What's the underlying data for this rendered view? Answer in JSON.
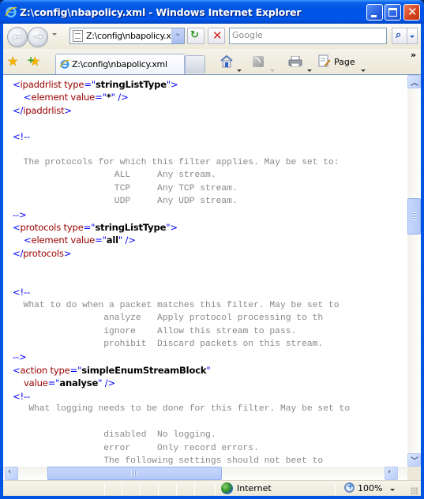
{
  "window": {
    "title": "Z:\\config\\nbapolicy.xml - Windows Internet Explorer"
  },
  "navbar": {
    "address_value": "Z:\\config\\nbapolicy.xml",
    "search_placeholder": "Google",
    "back_glyph": "←",
    "forward_glyph": "→",
    "refresh_glyph": "↻",
    "stop_glyph": "✕",
    "search_glyph": "⌕"
  },
  "tabs": [
    {
      "label": "Z:\\config\\nbapolicy.xml",
      "active": true
    }
  ],
  "command_bar": {
    "page_label": "Page",
    "more_glyph": "»"
  },
  "content": {
    "lines": [
      {
        "kind": "xml",
        "indent": 0,
        "parts": [
          [
            "blue",
            "<"
          ],
          [
            "tag",
            "ipaddrlist"
          ],
          [
            "attr",
            " type"
          ],
          [
            "blue",
            "=\""
          ],
          [
            "val",
            "stringListType"
          ],
          [
            "blue",
            "\">"
          ]
        ]
      },
      {
        "kind": "xml",
        "indent": 1,
        "parts": [
          [
            "blue",
            "<"
          ],
          [
            "tag",
            "element"
          ],
          [
            "attr",
            " value"
          ],
          [
            "blue",
            "=\""
          ],
          [
            "val",
            "*"
          ],
          [
            "blue",
            "\" />"
          ]
        ]
      },
      {
        "kind": "xml",
        "indent": 0,
        "parts": [
          [
            "blue",
            "</"
          ],
          [
            "tag",
            "ipaddrlist"
          ],
          [
            "blue",
            ">"
          ]
        ]
      },
      {
        "kind": "blank"
      },
      {
        "kind": "xml",
        "indent": 0,
        "parts": [
          [
            "cmt",
            "<!--"
          ]
        ]
      },
      {
        "kind": "blank"
      },
      {
        "kind": "mono",
        "text": "  The protocols for which this filter applies. May be set to:"
      },
      {
        "kind": "mono",
        "text": "                   ALL     Any stream."
      },
      {
        "kind": "mono",
        "text": "                   TCP     Any TCP stream."
      },
      {
        "kind": "mono",
        "text": "                   UDP     Any UDP stream."
      },
      {
        "kind": "xml",
        "indent": 0,
        "parts": [
          [
            "cmt",
            "-->"
          ]
        ]
      },
      {
        "kind": "xml",
        "indent": 0,
        "parts": [
          [
            "blue",
            "<"
          ],
          [
            "tag",
            "protocols"
          ],
          [
            "attr",
            " type"
          ],
          [
            "blue",
            "=\""
          ],
          [
            "val",
            "stringListType"
          ],
          [
            "blue",
            "\">"
          ]
        ]
      },
      {
        "kind": "xml",
        "indent": 1,
        "parts": [
          [
            "blue",
            "<"
          ],
          [
            "tag",
            "element"
          ],
          [
            "attr",
            " value"
          ],
          [
            "blue",
            "=\""
          ],
          [
            "val",
            "all"
          ],
          [
            "blue",
            "\" />"
          ]
        ]
      },
      {
        "kind": "xml",
        "indent": 0,
        "parts": [
          [
            "blue",
            "</"
          ],
          [
            "tag",
            "protocols"
          ],
          [
            "blue",
            ">"
          ]
        ]
      },
      {
        "kind": "blank"
      },
      {
        "kind": "blank"
      },
      {
        "kind": "xml",
        "indent": 0,
        "parts": [
          [
            "cmt",
            "<!--"
          ]
        ]
      },
      {
        "kind": "mono",
        "text": "  What to do when a packet matches this filter. May be set to"
      },
      {
        "kind": "mono",
        "text": "                 analyze   Apply protocol processing to th"
      },
      {
        "kind": "mono",
        "text": "                 ignore    Allow this stream to pass."
      },
      {
        "kind": "mono",
        "text": "                 prohibit  Discard packets on this stream."
      },
      {
        "kind": "xml",
        "indent": 0,
        "parts": [
          [
            "cmt",
            "-->"
          ]
        ]
      },
      {
        "kind": "xml",
        "indent": 0,
        "parts": [
          [
            "blue",
            "<"
          ],
          [
            "tag",
            "action"
          ],
          [
            "attr",
            " type"
          ],
          [
            "blue",
            "=\""
          ],
          [
            "val",
            "simpleEnumStreamBlock"
          ],
          [
            "blue",
            "\""
          ]
        ]
      },
      {
        "kind": "xml",
        "indent": 1,
        "parts": [
          [
            "attr",
            "value"
          ],
          [
            "blue",
            "=\""
          ],
          [
            "val",
            "analyse"
          ],
          [
            "blue",
            "\" />"
          ]
        ]
      },
      {
        "kind": "xml",
        "indent": 0,
        "parts": [
          [
            "cmt",
            "<!--"
          ]
        ]
      },
      {
        "kind": "mono",
        "text": "   What logging needs to be done for this filter. May be set to"
      },
      {
        "kind": "blank"
      },
      {
        "kind": "mono",
        "text": "                 disabled  No logging."
      },
      {
        "kind": "mono",
        "text": "                 error     Only record errors."
      },
      {
        "kind": "mono",
        "text": "                 The following settings should not beet to"
      }
    ]
  },
  "statusbar": {
    "zone_label": "Internet",
    "zoom_label": "100%"
  },
  "colors": {
    "title_bar": "#0054e3",
    "xml_markup": "#0000ff",
    "xml_name": "#990000",
    "comment_text": "#888888"
  }
}
